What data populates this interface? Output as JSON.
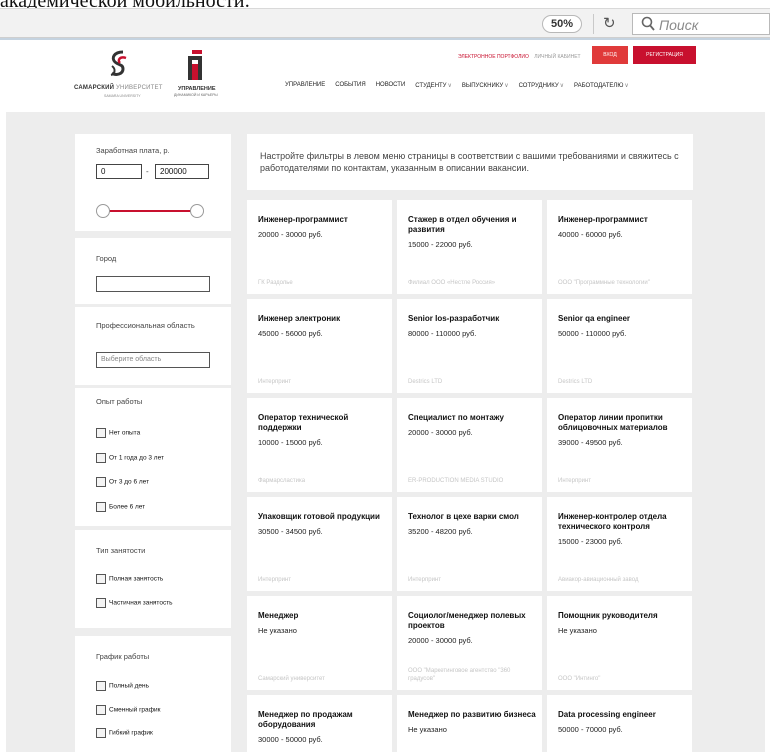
{
  "page_caption": "академической мобильности:",
  "browser": {
    "zoom": "50%",
    "search_placeholder": "Поиск"
  },
  "header": {
    "logo_samara_line1_a": "САМАРСКИЙ ",
    "logo_samara_line1_b": "УНИВЕРСИТЕТ",
    "logo_samara_line2": "SAMARA UNIVERSITY",
    "logo_uprav_line1": "УПРАВЛЕНИЕ",
    "logo_uprav_line2": "ДИНАМИКОЙ И КАРЬЕРЫ",
    "link_portfolio": "ЭЛЕКТРОННОЕ ПОРТФОЛИО",
    "link_cabinet": "ЛИЧНЫЙ КАБИНЕТ",
    "btn_login": "ВХОД",
    "btn_register": "РЕГИСТРАЦИЯ",
    "accent": "#c8102e",
    "nav": [
      {
        "label": "УПРАВЛЕНИЕ",
        "dropdown": false
      },
      {
        "label": "СОБЫТИЯ",
        "dropdown": false
      },
      {
        "label": "НОВОСТИ",
        "dropdown": false
      },
      {
        "label": "СТУДЕНТУ",
        "dropdown": true
      },
      {
        "label": "ВЫПУСКНИКУ",
        "dropdown": true
      },
      {
        "label": "СОТРУДНИКУ",
        "dropdown": true
      },
      {
        "label": "РАБОТОДАТЕЛЮ",
        "dropdown": true
      }
    ]
  },
  "filters": {
    "salary_label": "Заработная плата, р.",
    "salary_min": "0",
    "salary_max": "200000",
    "city_label": "Город",
    "city_value": "",
    "area_label": "Профессиональная область",
    "area_placeholder": "Выберите область",
    "experience_label": "Опыт работы",
    "experience_options": [
      "Нет опыта",
      "От 1 года до 3 лет",
      "От 3 до 6 лет",
      "Более 6 лет"
    ],
    "employment_label": "Тип занятости",
    "employment_options": [
      "Полная занятость",
      "Частичная занятость"
    ],
    "schedule_label": "График работы",
    "schedule_options": [
      "Полный день",
      "Сменный график",
      "Гибкий график"
    ]
  },
  "info_text": "Настройте фильтры в левом меню страницы в соответствии с вашими требованиями и свяжитесь с работодателями по контактам, указанным в описании вакансии.",
  "vacancies": [
    {
      "title": "Инженер-программист",
      "salary": "20000 - 30000 руб.",
      "company": "ГК Раздолье"
    },
    {
      "title": "Стажер в отдел обучения и развития",
      "salary": "15000 - 22000 руб.",
      "company": "Филиал ООО «Нестле Россия»"
    },
    {
      "title": "Инженер-программист",
      "salary": "40000 - 60000 руб.",
      "company": "ООО \"Программные технологии\""
    },
    {
      "title": "Инженер электроник",
      "salary": "45000 - 56000 руб.",
      "company": "Интерпринт"
    },
    {
      "title": "Senior Ios-разработчик",
      "salary": "80000 - 110000 руб.",
      "company": "Destrics LTD"
    },
    {
      "title": "Senior qa engineer",
      "salary": "50000 - 110000 руб.",
      "company": "Destrics LTD"
    },
    {
      "title": "Оператор технической поддержки",
      "salary": "10000 - 15000 руб.",
      "company": "Фармарсластика"
    },
    {
      "title": "Специалист по монтажу",
      "salary": "20000 - 30000 руб.",
      "company": "ER-PRODUCTION MEDIA STUDIO"
    },
    {
      "title": "Оператор линии пропитки облицовочных материалов",
      "salary": "39000 - 49500 руб.",
      "company": "Интерпринт"
    },
    {
      "title": "Упаковщик готовой продукции",
      "salary": "30500 - 34500 руб.",
      "company": "Интерпринт"
    },
    {
      "title": "Технолог в цехе варки смол",
      "salary": "35200 - 48200 руб.",
      "company": "Интерпринт"
    },
    {
      "title": "Инженер-контролер отдела технического контроля",
      "salary": "15000 - 23000 руб.",
      "company": "Авиакор-авиационный завод"
    },
    {
      "title": "Менеджер",
      "salary": "Не указано",
      "company": "Самарский университет"
    },
    {
      "title": "Социолог/менеджер полевых проектов",
      "salary": "20000 - 30000 руб.",
      "company": "ООО \"Маркетинговое агентство \"360 градусов\""
    },
    {
      "title": "Помощник руководителя",
      "salary": "Не указано",
      "company": "ООО \"Интинго\""
    },
    {
      "title": "Менеджер по продажам оборудования",
      "salary": "30000 - 50000 руб.",
      "company": ""
    },
    {
      "title": "Менеджер по развитию бизнеса",
      "salary": "Не указано",
      "company": ""
    },
    {
      "title": "Data processing engineer",
      "salary": "50000 - 70000 руб.",
      "company": ""
    }
  ]
}
